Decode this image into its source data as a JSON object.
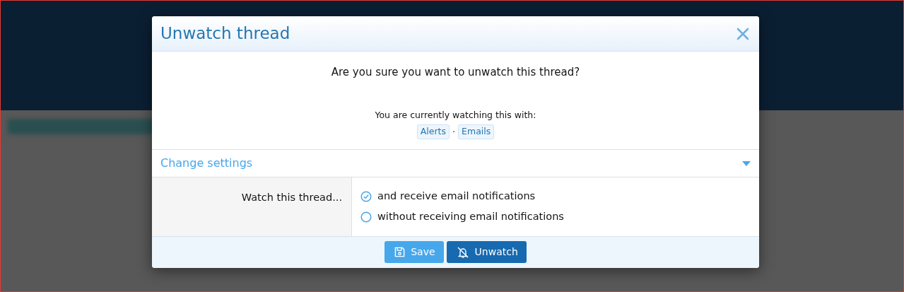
{
  "modal": {
    "title": "Unwatch thread",
    "question": "Are you sure you want to unwatch this thread?",
    "watching_label": "You are currently watching this with:",
    "watch_types": [
      {
        "label": "Alerts"
      },
      {
        "label": "Emails"
      }
    ],
    "separator": "·",
    "settings": {
      "title": "Change settings",
      "expanded": true
    },
    "field_label": "Watch this thread...",
    "options": [
      {
        "label": "and receive email notifications",
        "selected": true
      },
      {
        "label": "without receiving email notifications",
        "selected": false
      }
    ],
    "buttons": [
      {
        "label": "Save",
        "kind": "save"
      },
      {
        "label": "Unwatch",
        "kind": "unwatch"
      }
    ]
  }
}
